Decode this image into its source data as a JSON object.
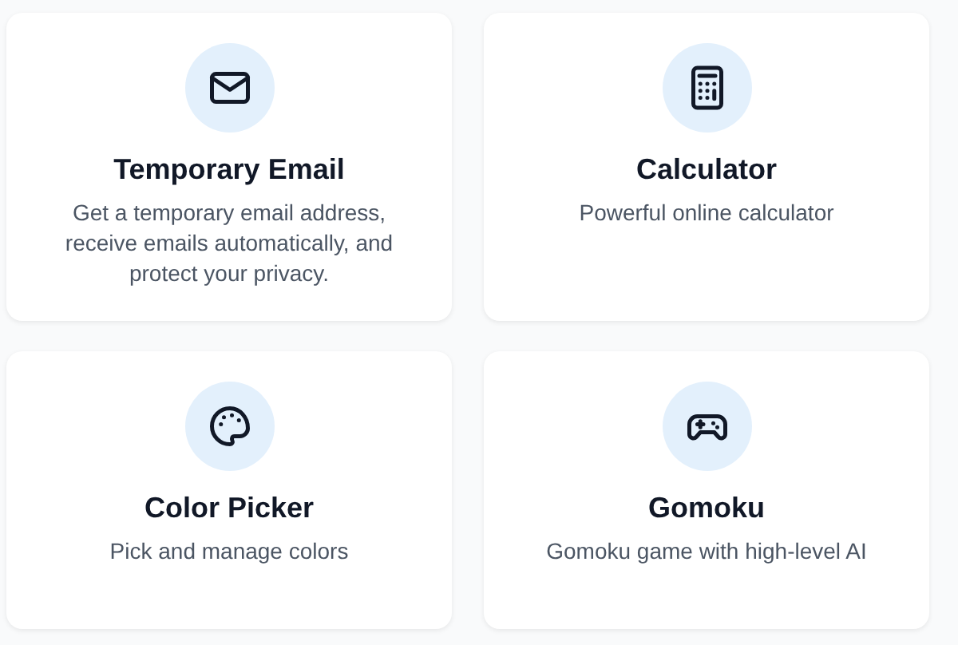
{
  "tools": [
    {
      "title": "Temporary Email",
      "description": "Get a temporary email address, receive emails automatically, and protect your privacy."
    },
    {
      "title": "Calculator",
      "description": "Powerful online calculator"
    },
    {
      "title": "Color Picker",
      "description": "Pick and manage colors"
    },
    {
      "title": "Gomoku",
      "description": "Gomoku game with high-level AI"
    }
  ]
}
